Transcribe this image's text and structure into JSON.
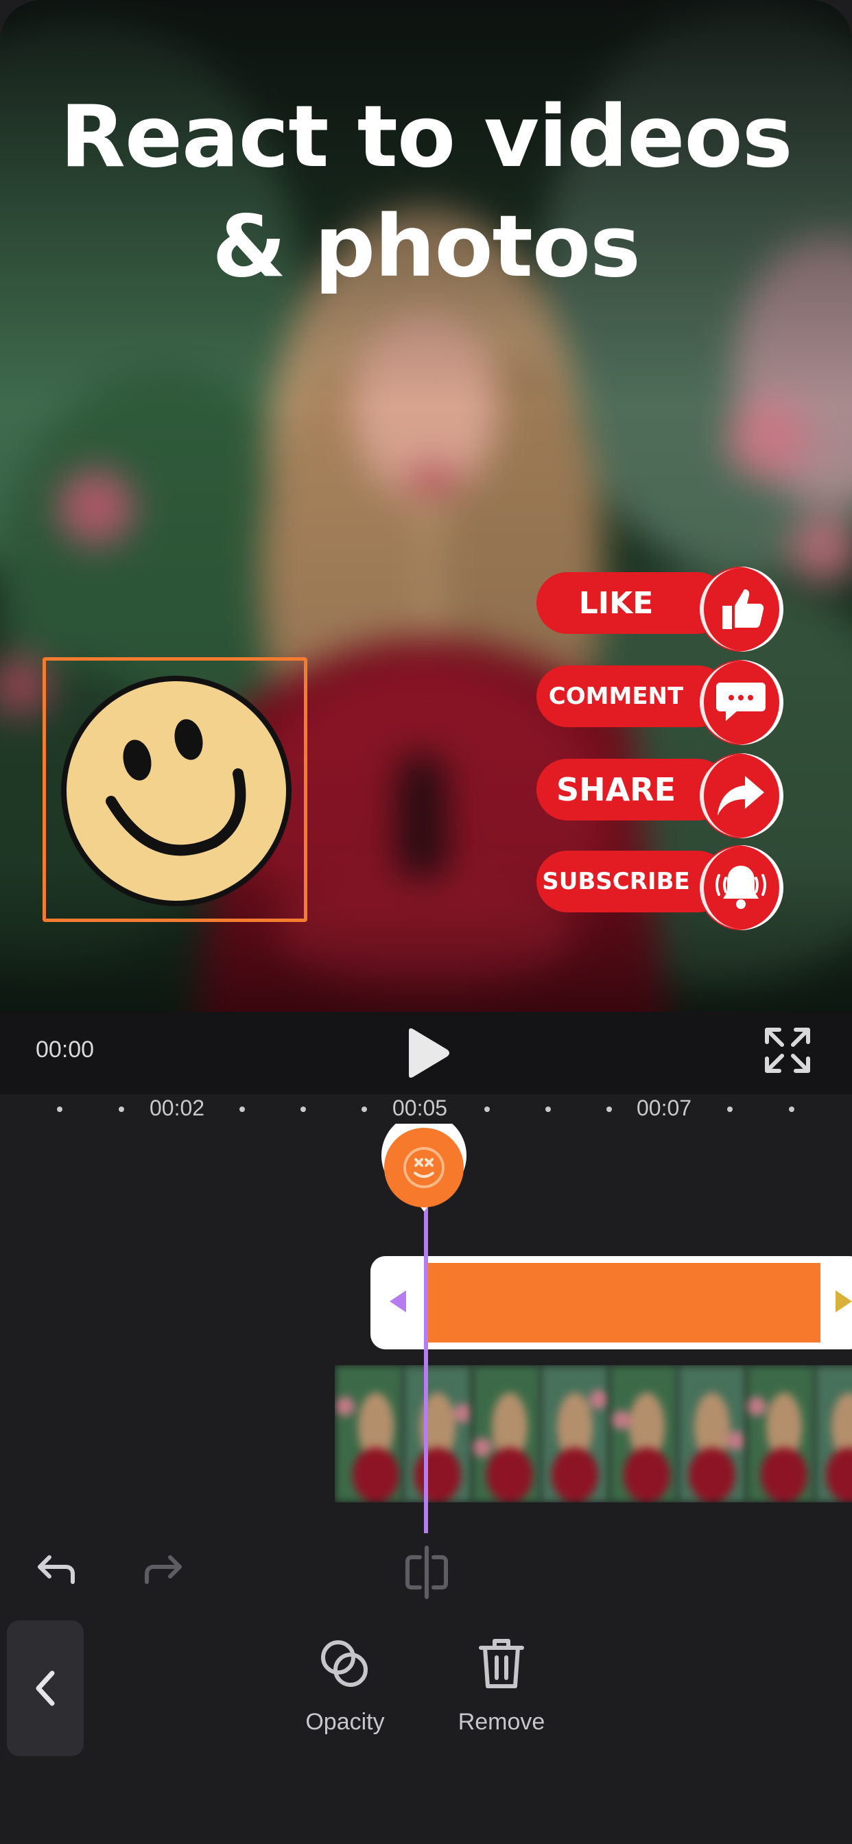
{
  "headline": {
    "line1": "React to videos",
    "line2": "& photos"
  },
  "cta_buttons": [
    {
      "label": "LIKE",
      "icon": "thumbs-up-icon"
    },
    {
      "label": "COMMENT",
      "icon": "speech-bubble-icon"
    },
    {
      "label": "SHARE",
      "icon": "share-arrow-icon"
    },
    {
      "label": "SUBSCRIBE",
      "icon": "bell-icon"
    }
  ],
  "player": {
    "current_time": "00:00"
  },
  "timeline": {
    "markers": [
      "00:02",
      "00:05",
      "00:07"
    ]
  },
  "toolbar": {
    "opacity_label": "Opacity",
    "remove_label": "Remove"
  },
  "colors": {
    "accent_orange": "#f7792b",
    "playhead_purple": "#b77cf0",
    "cta_red": "#e31b23",
    "background": "#1d1d1f"
  }
}
